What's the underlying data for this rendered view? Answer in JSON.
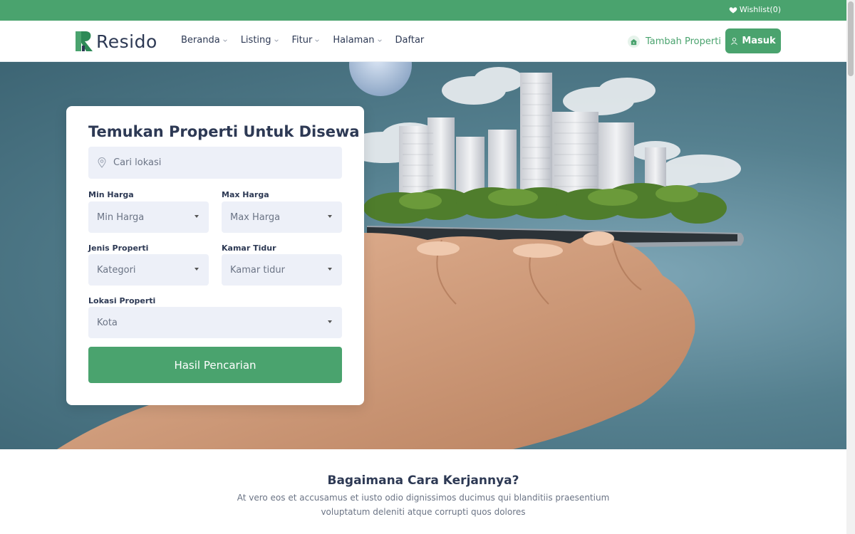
{
  "topbar": {
    "wishlist_label": "Wishlist(0)",
    "wishlist_icon": "heart-icon"
  },
  "header": {
    "brand": "Resido",
    "nav": [
      {
        "label": "Beranda",
        "has_dropdown": true
      },
      {
        "label": "Listing",
        "has_dropdown": true
      },
      {
        "label": "Fitur",
        "has_dropdown": true
      },
      {
        "label": "Halaman",
        "has_dropdown": true
      },
      {
        "label": "Daftar",
        "has_dropdown": false
      }
    ],
    "add_property_label": "Tambah Properti",
    "login_label": "Masuk"
  },
  "search": {
    "title": "Temukan Properti Untuk Disewa",
    "location_placeholder": "Cari lokasi",
    "min_price_label": "Min Harga",
    "min_price_value": "Min Harga",
    "max_price_label": "Max Harga",
    "max_price_value": "Max Harga",
    "type_label": "Jenis Properti",
    "type_value": "Kategori",
    "bedrooms_label": "Kamar Tidur",
    "bedrooms_value": "Kamar tidur",
    "location_label": "Lokasi Properti",
    "location_value": "Kota",
    "submit_label": "Hasil Pencarian"
  },
  "how_it_works": {
    "title": "Bagaimana Cara Kerjannya?",
    "description": "At vero eos et accusamus et iusto odio dignissimos ducimus qui blanditiis praesentium voluptatum deleniti atque corrupti quos dolores"
  },
  "colors": {
    "brand": "#4aa36e",
    "text": "#2d3954",
    "field_bg": "#edf0f8"
  }
}
